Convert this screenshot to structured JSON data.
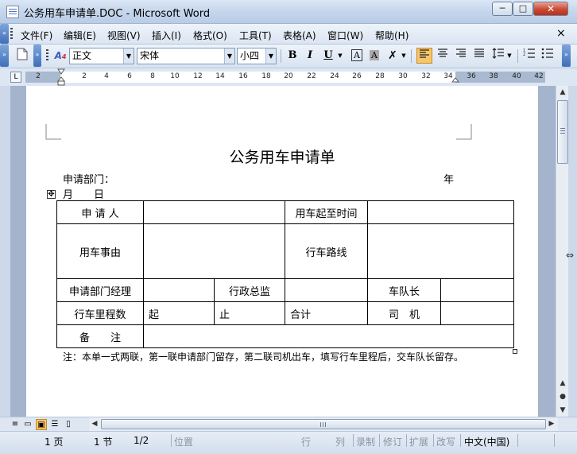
{
  "window": {
    "title": "公务用车申请单.DOC - Microsoft Word",
    "controls": {
      "minimize": "─",
      "maximize": "□",
      "close": "✕"
    }
  },
  "menubar": {
    "items": [
      "文件(F)",
      "编辑(E)",
      "视图(V)",
      "插入(I)",
      "格式(O)",
      "工具(T)",
      "表格(A)",
      "窗口(W)",
      "帮助(H)"
    ],
    "close_glyph": "×"
  },
  "toolbar": {
    "style_value": "正文",
    "font_value": "宋体",
    "size_value": "小四",
    "bold": "B",
    "italic": "I",
    "underline": "U",
    "char_border": "A",
    "char_shading": "A",
    "icons": [
      "new-doc-icon",
      "styles-icon",
      "bold-icon",
      "italic-icon",
      "underline-icon",
      "char-border-icon",
      "char-shading-icon",
      "highlight-icon",
      "align-left-icon",
      "center-icon",
      "align-right-icon",
      "justify-icon",
      "line-spacing-icon",
      "numbering-icon",
      "bullets-icon"
    ],
    "accent_color": "#f6c66b"
  },
  "ruler": {
    "ticks": [
      "2",
      "2",
      "4",
      "6",
      "8",
      "10",
      "12",
      "14",
      "16",
      "18",
      "20",
      "22",
      "24",
      "26",
      "28",
      "30",
      "32",
      "34",
      "36",
      "38",
      "40",
      "42"
    ],
    "tab_selector": "L"
  },
  "document": {
    "title": "公务用车申请单",
    "dept_label": "申请部门：",
    "year_label": "年",
    "date_label": "月　　日",
    "table": {
      "applicant": "申 请 人",
      "time_range": "用车起至时间",
      "reason": "用车事由",
      "route": "行车路线",
      "dept_manager": "申请部门经理",
      "admin_director": "行政总监",
      "fleet_leader": "车队长",
      "mileage": "行车里程数",
      "start": "起",
      "end": "止",
      "total": "合计",
      "driver": "司　机",
      "remarks": "备　　注"
    },
    "note": "注：本单一式两联，第一联申请部门留存，第二联司机出车，填写行车里程后，交车队长留存。"
  },
  "statusbar": {
    "page": "1 页",
    "section": "1 节",
    "page_of": "1/2",
    "position": "位置",
    "line": "行",
    "column": "列",
    "rec": "录制",
    "trk": "修订",
    "ext": "扩展",
    "ovr": "改写",
    "language": "中文(中国)"
  }
}
